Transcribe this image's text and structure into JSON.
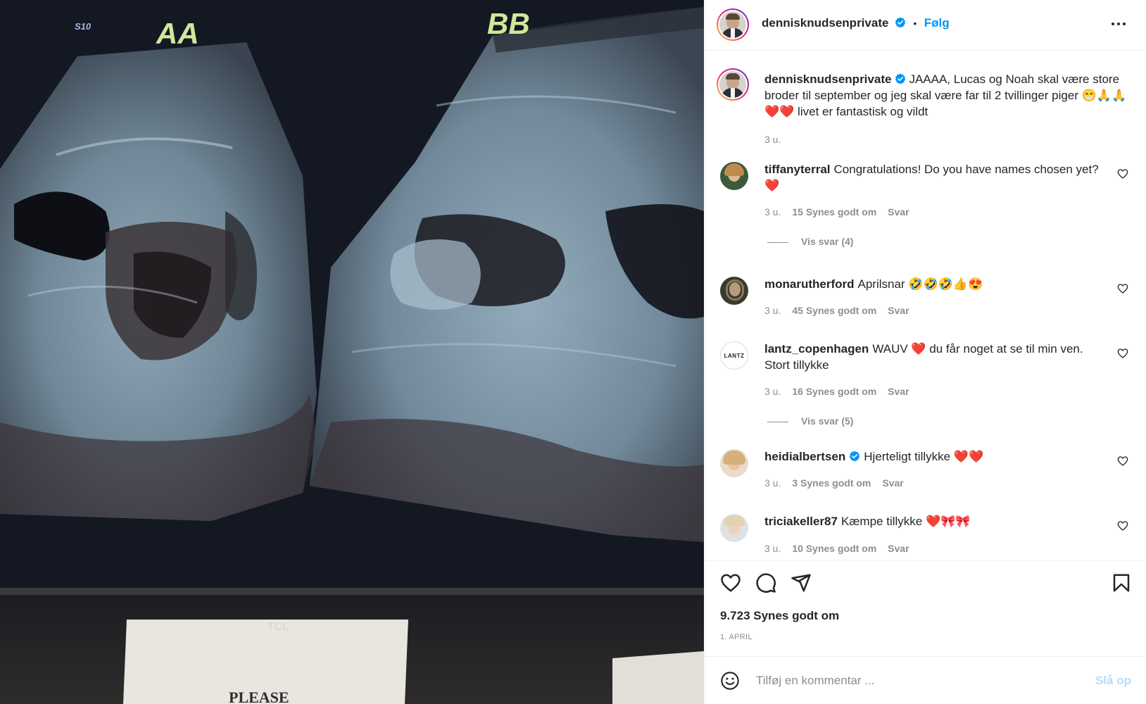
{
  "media": {
    "label_left": "AA",
    "label_right": "BB",
    "small_label": "S10",
    "tv_brand": "TCL",
    "sign_text": "PLEASE"
  },
  "header": {
    "username": "dennisknudsenprivate",
    "separator": "•",
    "follow_label": "Følg"
  },
  "caption": {
    "username": "dennisknudsenprivate",
    "text": "JAAAA, Lucas og Noah skal være store broder til september og jeg skal være far til 2 tvillinger piger 😁🙏🙏❤️❤️ livet er fantastisk og vildt",
    "time": "3 u."
  },
  "comments": [
    {
      "username": "tiffanyterral",
      "verified": false,
      "text": "Congratulations! Do you have names chosen yet? ❤️",
      "time": "3 u.",
      "likes": "15 Synes godt om",
      "reply": "Svar",
      "view_replies": "Vis svar (4)",
      "avatar_color": "#c99a6a"
    },
    {
      "username": "monarutherford",
      "verified": false,
      "text": "Aprilsnar 🤣🤣🤣👍😍",
      "time": "3 u.",
      "likes": "45 Synes godt om",
      "reply": "Svar",
      "view_replies": "",
      "avatar_color": "#4a4637"
    },
    {
      "username": "lantz_copenhagen",
      "verified": false,
      "text": "WAUV ❤️ du får noget at se til min ven. Stort tillykke",
      "time": "3 u.",
      "likes": "16 Synes godt om",
      "reply": "Svar",
      "view_replies": "Vis svar (5)",
      "avatar_text": "LANTZ"
    },
    {
      "username": "heidialbertsen",
      "verified": true,
      "text": "Hjerteligt tillykke ❤️❤️",
      "time": "3 u.",
      "likes": "3 Synes godt om",
      "reply": "Svar",
      "view_replies": "",
      "avatar_color": "#d8b99a"
    },
    {
      "username": "triciakeller87",
      "verified": false,
      "text": "Kæmpe tillykke ❤️🎀🎀",
      "time": "3 u.",
      "likes": "10 Synes godt om",
      "reply": "Svar",
      "view_replies": "",
      "avatar_color": "#cfd3d6"
    }
  ],
  "actions": {
    "likes": "9.723 Synes godt om",
    "date": "1. APRIL"
  },
  "composer": {
    "placeholder": "Tilføj en kommentar ...",
    "post_label": "Slå op"
  },
  "colors": {
    "accent": "#0095f6",
    "heart": "#ed4956",
    "muted": "#8e8e8e"
  }
}
